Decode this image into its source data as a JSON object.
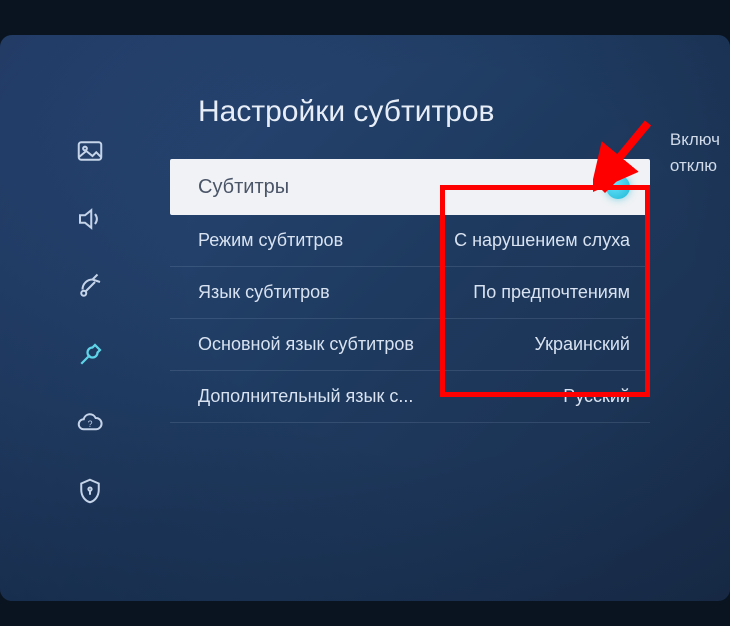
{
  "title": "Настройки субтитров",
  "toggle": {
    "label": "Субтитры",
    "on": true
  },
  "settings": [
    {
      "label": "Режим субтитров",
      "value": "С нарушением слуха"
    },
    {
      "label": "Язык субтитров",
      "value": "По предпочтениям"
    },
    {
      "label": "Основной язык субтитров",
      "value": "Украинский"
    },
    {
      "label": "Дополнительный язык с...",
      "value": "Русский"
    }
  ],
  "sideText": {
    "line1": "Включ",
    "line2": "отклю"
  },
  "sidebar": {
    "items": [
      {
        "name": "picture",
        "active": false
      },
      {
        "name": "sound",
        "active": false
      },
      {
        "name": "broadcast",
        "active": false
      },
      {
        "name": "general",
        "active": true
      },
      {
        "name": "support",
        "active": false
      },
      {
        "name": "privacy",
        "active": false
      }
    ]
  }
}
